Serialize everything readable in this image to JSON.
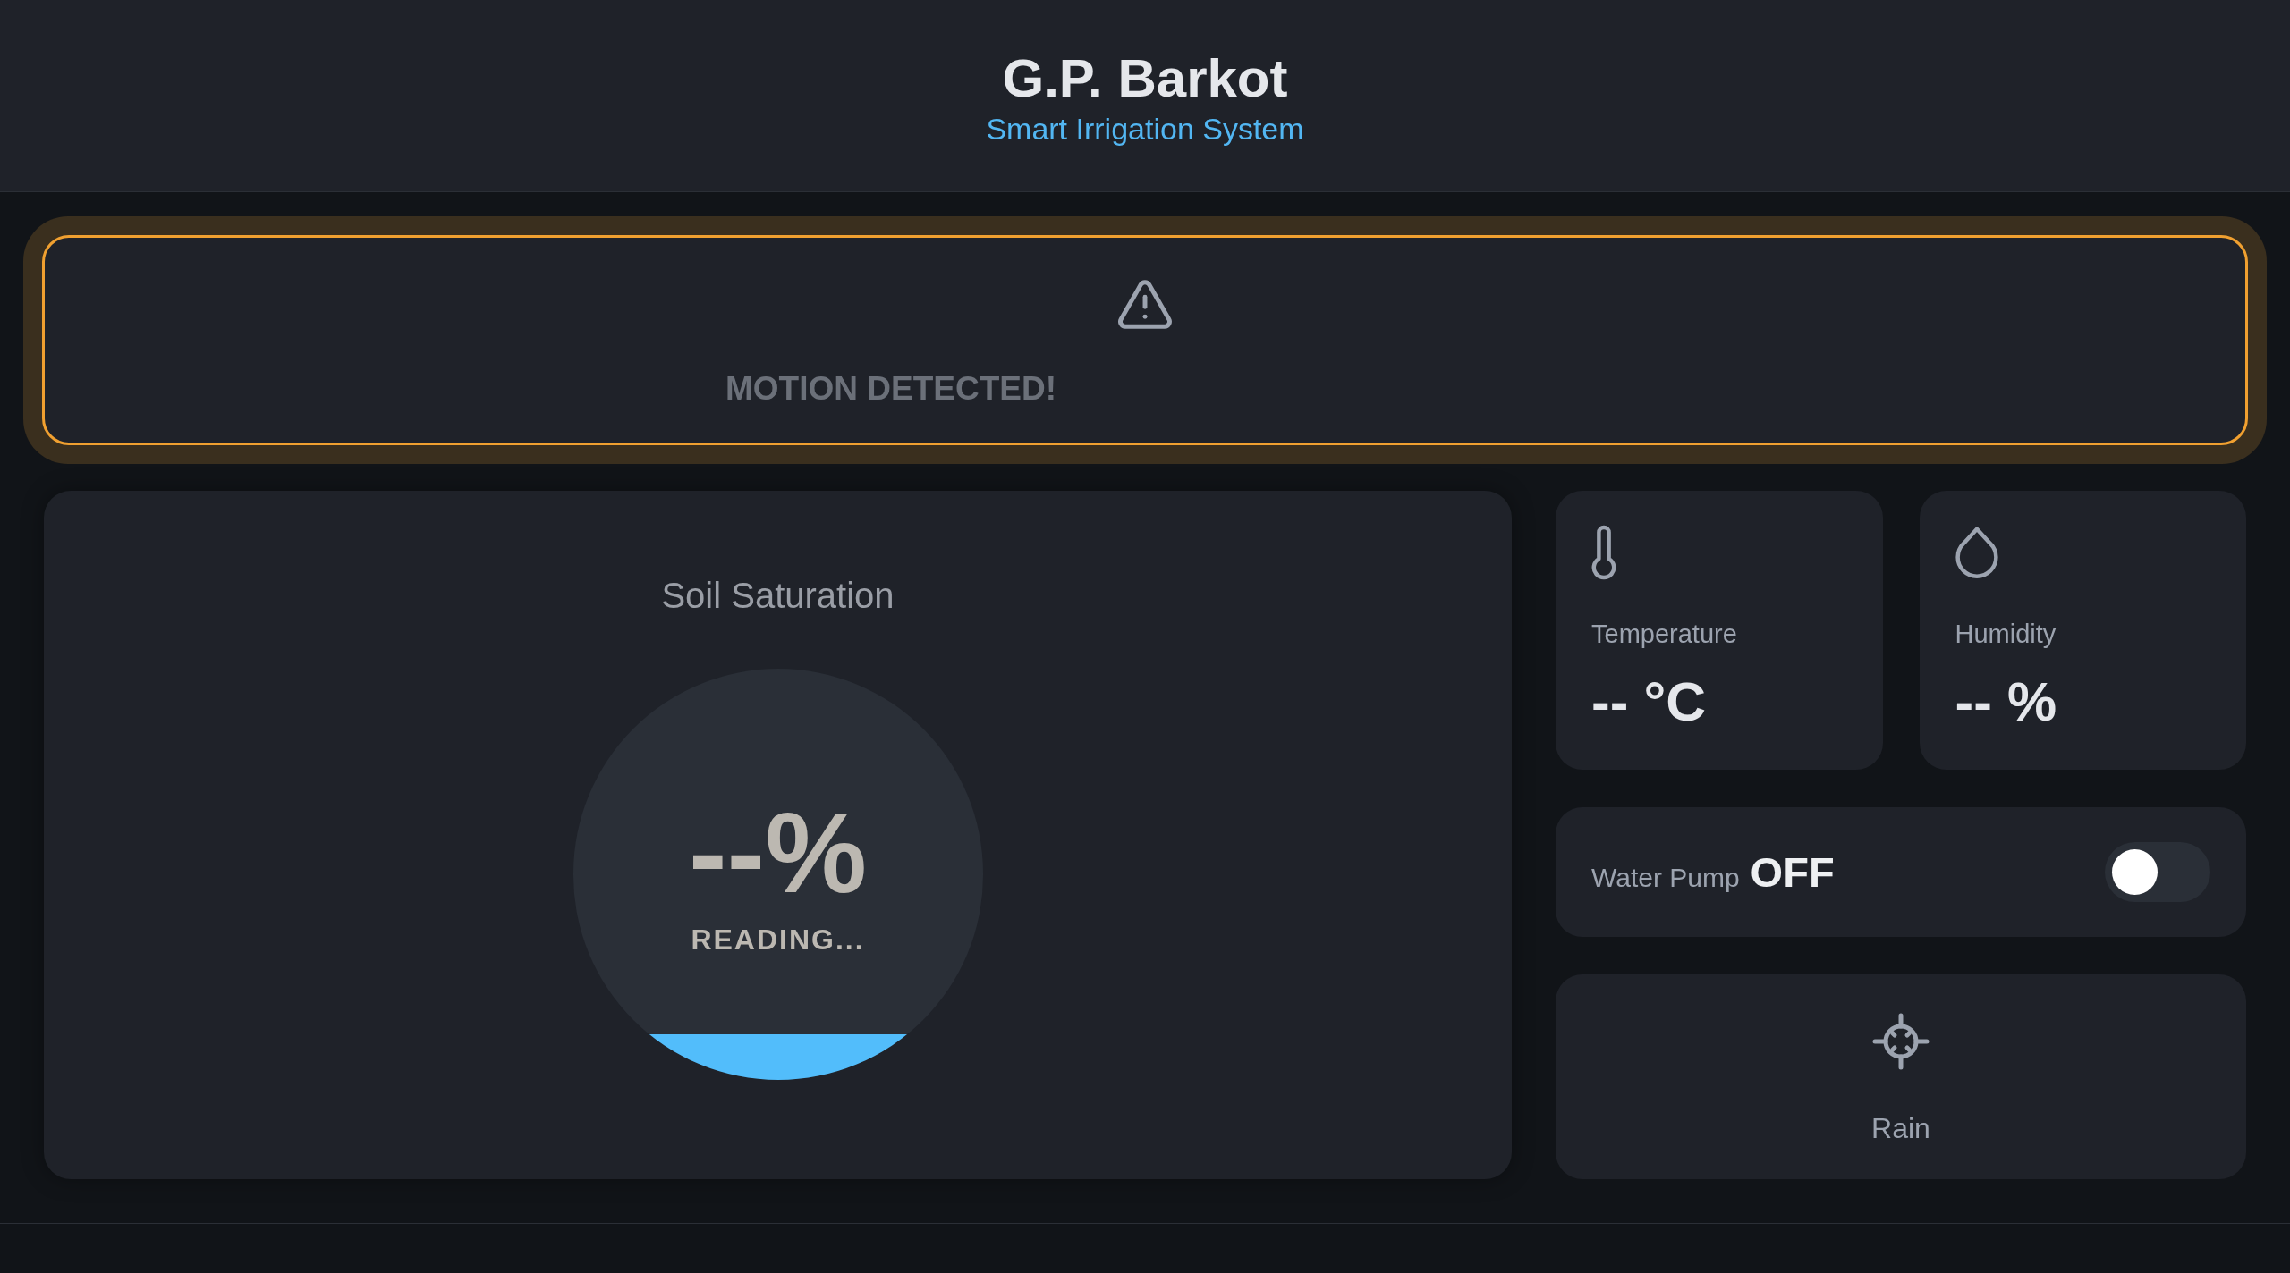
{
  "header": {
    "title": "G.P. Barkot",
    "subtitle": "Smart Irrigation System"
  },
  "alert": {
    "active": true,
    "message": "MOTION DETECTED!"
  },
  "soil_saturation": {
    "title": "Soil Saturation",
    "value": "--%",
    "status": "READING...",
    "level": 0.11
  },
  "sensors": [
    {
      "kind": "temperature",
      "label": "Temperature",
      "value": "-- °C"
    },
    {
      "kind": "humidity",
      "label": "Humidity",
      "value": "-- %"
    }
  ],
  "pump": {
    "label": "Water Pump",
    "state": "OFF",
    "on": false
  },
  "rain": {
    "label": "Rain"
  }
}
